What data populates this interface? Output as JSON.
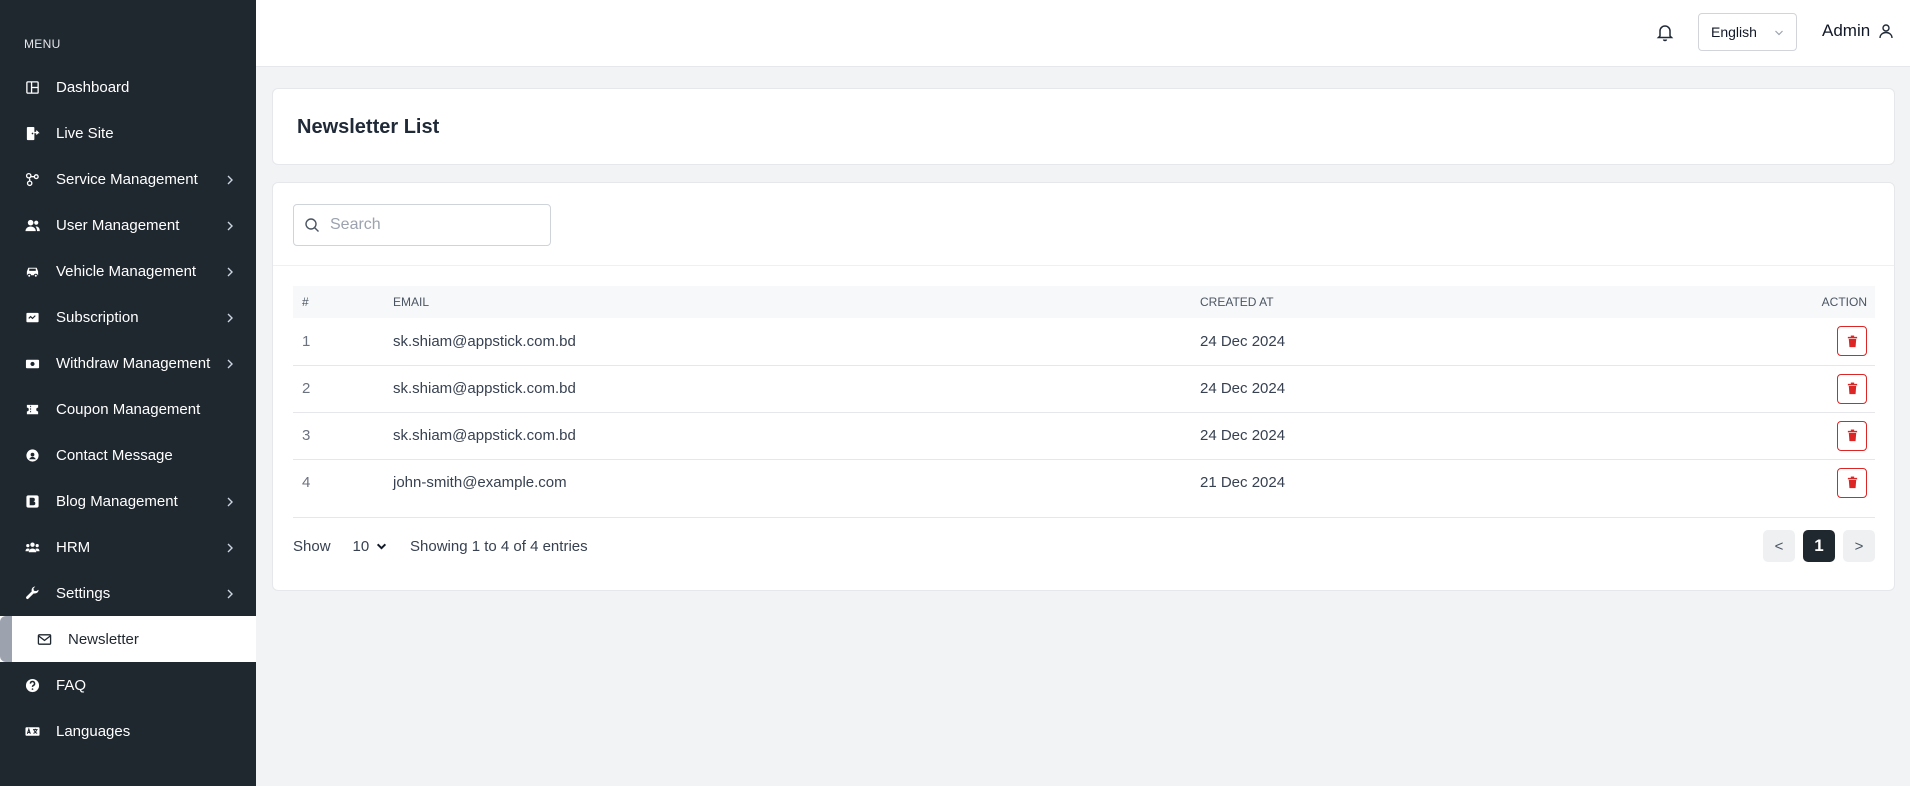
{
  "sidebar": {
    "heading": "MENU",
    "items": [
      {
        "label": "Dashboard",
        "icon": "dashboard-icon",
        "has_children": false
      },
      {
        "label": "Live Site",
        "icon": "live-site-icon",
        "has_children": false
      },
      {
        "label": "Service Management",
        "icon": "service-icon",
        "has_children": true
      },
      {
        "label": "User Management",
        "icon": "users-icon",
        "has_children": true
      },
      {
        "label": "Vehicle Management",
        "icon": "car-icon",
        "has_children": true
      },
      {
        "label": "Subscription",
        "icon": "subscription-icon",
        "has_children": true
      },
      {
        "label": "Withdraw Management",
        "icon": "money-icon",
        "has_children": true
      },
      {
        "label": "Coupon Management",
        "icon": "coupon-icon",
        "has_children": false
      },
      {
        "label": "Contact Message",
        "icon": "contact-icon",
        "has_children": false
      },
      {
        "label": "Blog Management",
        "icon": "blog-icon",
        "has_children": true
      },
      {
        "label": "HRM",
        "icon": "hrm-icon",
        "has_children": true
      },
      {
        "label": "Settings",
        "icon": "wrench-icon",
        "has_children": true
      },
      {
        "label": "Newsletter",
        "icon": "envelope-icon",
        "has_children": false,
        "active": true
      },
      {
        "label": "FAQ",
        "icon": "question-icon",
        "has_children": false
      },
      {
        "label": "Languages",
        "icon": "language-icon",
        "has_children": false
      }
    ]
  },
  "topbar": {
    "language": "English",
    "user": "Admin"
  },
  "page": {
    "title": "Newsletter List"
  },
  "search": {
    "placeholder": "Search",
    "value": ""
  },
  "table": {
    "headers": {
      "num": "#",
      "email": "EMAIL",
      "created_at": "CREATED AT",
      "action": "ACTION"
    },
    "rows": [
      {
        "num": "1",
        "email": "sk.shiam@appstick.com.bd",
        "created_at": "24 Dec 2024"
      },
      {
        "num": "2",
        "email": "sk.shiam@appstick.com.bd",
        "created_at": "24 Dec 2024"
      },
      {
        "num": "3",
        "email": "sk.shiam@appstick.com.bd",
        "created_at": "24 Dec 2024"
      },
      {
        "num": "4",
        "email": "john-smith@example.com",
        "created_at": "21 Dec 2024"
      }
    ]
  },
  "footer": {
    "show_label": "Show",
    "page_size": "10",
    "entries_text": "Showing 1 to 4 of 4 entries",
    "prev": "<",
    "current_page": "1",
    "next": ">"
  },
  "colors": {
    "sidebar_bg": "#1f272f",
    "danger": "#dc2626",
    "page_bg": "#f2f3f5"
  }
}
